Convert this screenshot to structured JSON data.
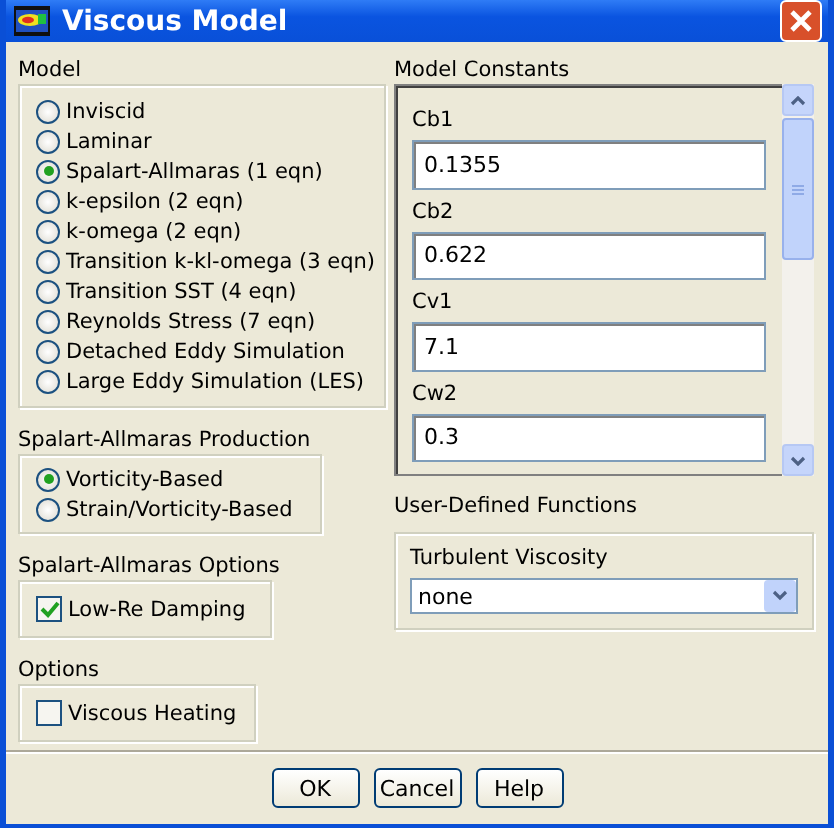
{
  "window": {
    "title": "Viscous Model"
  },
  "model": {
    "label": "Model",
    "options": [
      {
        "label": "Inviscid",
        "selected": false
      },
      {
        "label": "Laminar",
        "selected": false
      },
      {
        "label": "Spalart-Allmaras (1 eqn)",
        "selected": true
      },
      {
        "label": "k-epsilon (2 eqn)",
        "selected": false
      },
      {
        "label": "k-omega (2 eqn)",
        "selected": false
      },
      {
        "label": "Transition k-kl-omega (3 eqn)",
        "selected": false
      },
      {
        "label": "Transition SST (4 eqn)",
        "selected": false
      },
      {
        "label": "Reynolds Stress (7 eqn)",
        "selected": false
      },
      {
        "label": "Detached Eddy Simulation",
        "selected": false
      },
      {
        "label": "Large Eddy Simulation (LES)",
        "selected": false
      }
    ]
  },
  "production": {
    "label": "Spalart-Allmaras Production",
    "options": [
      {
        "label": "Vorticity-Based",
        "selected": true
      },
      {
        "label": "Strain/Vorticity-Based",
        "selected": false
      }
    ]
  },
  "sa_options": {
    "label": "Spalart-Allmaras Options",
    "items": [
      {
        "label": "Low-Re Damping",
        "checked": true
      }
    ]
  },
  "options": {
    "label": "Options",
    "items": [
      {
        "label": "Viscous Heating",
        "checked": false
      }
    ]
  },
  "model_constants": {
    "label": "Model Constants",
    "fields": [
      {
        "label": "Cb1",
        "value": "0.1355"
      },
      {
        "label": "Cb2",
        "value": "0.622"
      },
      {
        "label": "Cv1",
        "value": "7.1"
      },
      {
        "label": "Cw2",
        "value": "0.3"
      }
    ]
  },
  "udf": {
    "label": "User-Defined Functions",
    "field": {
      "label": "Turbulent Viscosity",
      "value": "none"
    }
  },
  "buttons": [
    "OK",
    "Cancel",
    "Help"
  ]
}
